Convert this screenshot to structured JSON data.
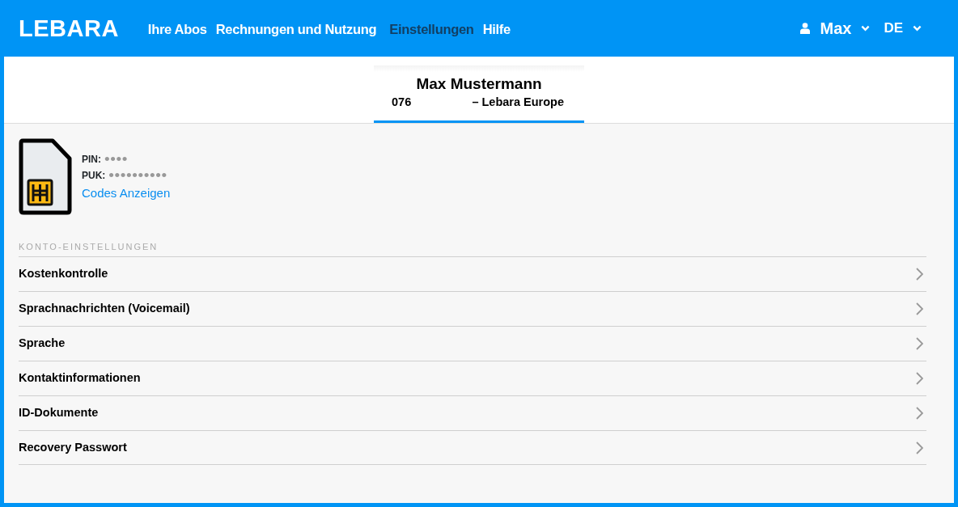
{
  "header": {
    "logo": "LEBARA",
    "nav": [
      {
        "label": "Ihre Abos",
        "selected": false
      },
      {
        "label": "Rechnungen und Nutzung",
        "selected": false
      },
      {
        "label": "Einstellungen",
        "selected": true
      },
      {
        "label": "Hilfe",
        "selected": false
      }
    ],
    "user": "Max",
    "language": "DE"
  },
  "account_tabs": [
    {
      "name": "Max Mustermann",
      "number": "076",
      "operator": "– Lebara Europe",
      "selected": true
    }
  ],
  "sim": {
    "pin_label": "PIN:",
    "pin": "••••",
    "puk_label": "PUK:",
    "puk": "••••••••••",
    "link": "Codes Anzeigen"
  },
  "settings": {
    "heading": "KONTO-EINSTELLUNGEN",
    "items": [
      "Kostenkontrolle",
      "Sprachnachrichten (Voicemail)",
      "Sprache",
      "Kontaktinformationen",
      "ID-Dokumente",
      "Recovery Passwort"
    ]
  }
}
